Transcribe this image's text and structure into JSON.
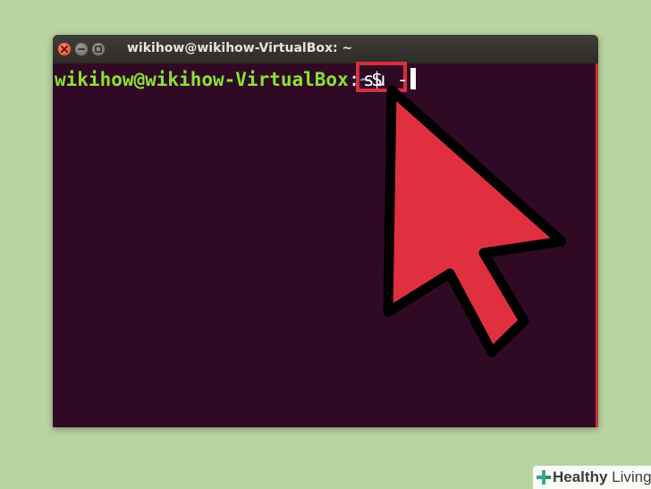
{
  "window": {
    "title": "wikihow@wikihow-VirtualBox: ~"
  },
  "terminal": {
    "prompt_user": "wikihow@wikihow-VirtualBox",
    "prompt_sep": ":",
    "prompt_path": "~",
    "prompt_dollar": "$ ",
    "command": "su -"
  },
  "watermark": {
    "bold": "Healthy",
    "rest": " Living"
  },
  "colors": {
    "background": "#b8d4a0",
    "terminal_bg": "#300a24",
    "prompt_user": "#8ae234",
    "prompt_path": "#729fcf",
    "highlight": "#d6303e",
    "arrow_fill": "#e03040"
  },
  "icons": {
    "close": "close-icon",
    "minimize": "minimize-icon",
    "maximize": "maximize-icon",
    "pointer": "arrow-pointer-icon",
    "logo": "healthy-living-logo-icon"
  }
}
